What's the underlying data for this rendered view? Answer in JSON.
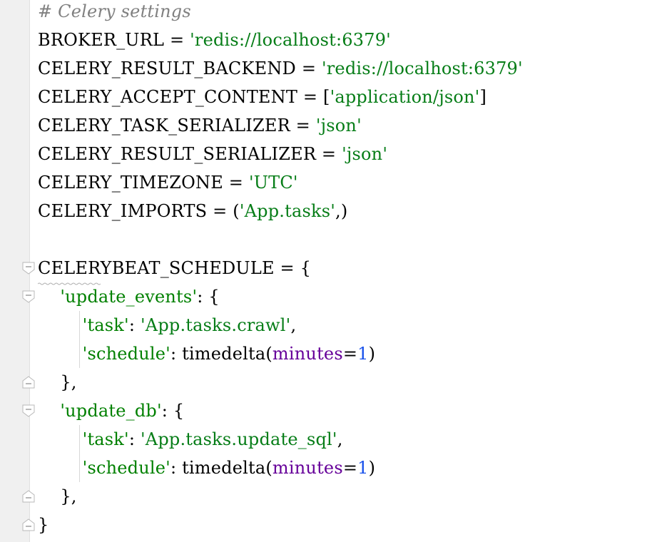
{
  "editor": {
    "lines": [
      {
        "segments": [
          {
            "cls": "comment",
            "text": "# Celery settings"
          }
        ]
      },
      {
        "segments": [
          {
            "cls": "plain",
            "text": "BROKER_URL = "
          },
          {
            "cls": "str",
            "text": "'redis://localhost:6379'"
          }
        ]
      },
      {
        "segments": [
          {
            "cls": "plain",
            "text": "CELERY_RESULT_BACKEND = "
          },
          {
            "cls": "str",
            "text": "'redis://localhost:6379'"
          }
        ]
      },
      {
        "segments": [
          {
            "cls": "plain",
            "text": "CELERY_ACCEPT_CONTENT = ["
          },
          {
            "cls": "str",
            "text": "'application/json'"
          },
          {
            "cls": "plain",
            "text": "]"
          }
        ]
      },
      {
        "segments": [
          {
            "cls": "plain",
            "text": "CELERY_TASK_SERIALIZER = "
          },
          {
            "cls": "str",
            "text": "'json'"
          }
        ]
      },
      {
        "segments": [
          {
            "cls": "plain",
            "text": "CELERY_RESULT_SERIALIZER = "
          },
          {
            "cls": "str",
            "text": "'json'"
          }
        ]
      },
      {
        "segments": [
          {
            "cls": "plain",
            "text": "CELERY_TIMEZONE = "
          },
          {
            "cls": "str",
            "text": "'UTC'"
          }
        ]
      },
      {
        "segments": [
          {
            "cls": "plain",
            "text": "CELERY_IMPORTS = ("
          },
          {
            "cls": "str",
            "text": "'App.tasks'"
          },
          {
            "cls": "plain",
            "text": ",)"
          }
        ]
      },
      {
        "segments": []
      },
      {
        "segments": [
          {
            "cls": "plain",
            "text": "CELERYBEAT_SCHEDULE = {"
          }
        ]
      },
      {
        "segments": [
          {
            "cls": "plain",
            "text": "    "
          },
          {
            "cls": "str-key",
            "text": "'update_events'"
          },
          {
            "cls": "plain",
            "text": ": {"
          }
        ]
      },
      {
        "segments": [
          {
            "cls": "plain",
            "text": "        "
          },
          {
            "cls": "str-key",
            "text": "'task'"
          },
          {
            "cls": "plain",
            "text": ": "
          },
          {
            "cls": "str",
            "text": "'App.tasks.crawl'"
          },
          {
            "cls": "plain",
            "text": ","
          }
        ]
      },
      {
        "segments": [
          {
            "cls": "plain",
            "text": "        "
          },
          {
            "cls": "str-key",
            "text": "'schedule'"
          },
          {
            "cls": "plain",
            "text": ": timedelta("
          },
          {
            "cls": "kw-arg",
            "text": "minutes"
          },
          {
            "cls": "plain",
            "text": "="
          },
          {
            "cls": "num",
            "text": "1"
          },
          {
            "cls": "plain",
            "text": ")"
          }
        ]
      },
      {
        "segments": [
          {
            "cls": "plain",
            "text": "    },"
          }
        ]
      },
      {
        "segments": [
          {
            "cls": "plain",
            "text": "    "
          },
          {
            "cls": "str-key",
            "text": "'update_db'"
          },
          {
            "cls": "plain",
            "text": ": {"
          }
        ]
      },
      {
        "segments": [
          {
            "cls": "plain",
            "text": "        "
          },
          {
            "cls": "str-key",
            "text": "'task'"
          },
          {
            "cls": "plain",
            "text": ": "
          },
          {
            "cls": "str",
            "text": "'App.tasks.update_sql'"
          },
          {
            "cls": "plain",
            "text": ","
          }
        ]
      },
      {
        "segments": [
          {
            "cls": "plain",
            "text": "        "
          },
          {
            "cls": "str-key",
            "text": "'schedule'"
          },
          {
            "cls": "plain",
            "text": ": timedelta("
          },
          {
            "cls": "kw-arg",
            "text": "minutes"
          },
          {
            "cls": "plain",
            "text": "="
          },
          {
            "cls": "num",
            "text": "1"
          },
          {
            "cls": "plain",
            "text": ")"
          }
        ]
      },
      {
        "segments": [
          {
            "cls": "plain",
            "text": "    },"
          }
        ]
      },
      {
        "segments": [
          {
            "cls": "plain",
            "text": "}"
          }
        ]
      }
    ],
    "colors": {
      "comment": "#808080",
      "string": "#067d17",
      "dict_key": "#008000",
      "keyword_arg": "#660099",
      "number": "#1750eb",
      "gutter": "#f0f0f0"
    },
    "fold_markers": [
      {
        "line": 9,
        "kind": "fold-open-icon"
      },
      {
        "line": 10,
        "kind": "fold-open-icon"
      },
      {
        "line": 13,
        "kind": "fold-close-icon"
      },
      {
        "line": 14,
        "kind": "fold-open-icon"
      },
      {
        "line": 17,
        "kind": "fold-close-icon"
      },
      {
        "line": 18,
        "kind": "fold-close-icon"
      }
    ]
  }
}
